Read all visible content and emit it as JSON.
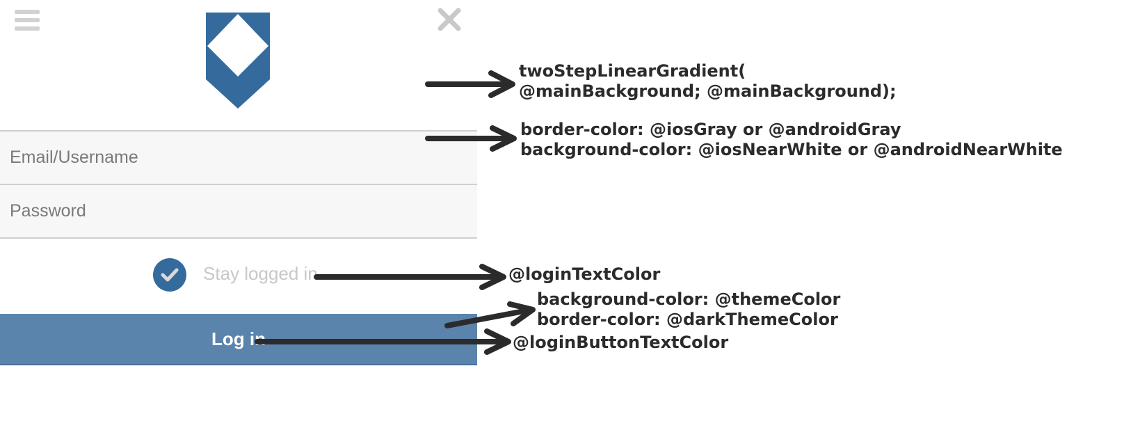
{
  "header": {
    "menu_icon": "hamburger-menu-icon",
    "close_icon": "close-icon",
    "logo_icon": "shield-logo-icon",
    "logo_color": "#356a9d"
  },
  "form": {
    "email_placeholder": "Email/Username",
    "password_placeholder": "Password",
    "stay_logged_in_label": "Stay logged in",
    "stay_logged_in_checked": true,
    "login_button_label": "Log in",
    "field_background": "#f7f7f7",
    "field_border": "#cfcfcf",
    "button_background": "#5b84ad",
    "checkbox_color": "#356a9d"
  },
  "annotations": {
    "background_line1": "twoStepLinearGradient(",
    "background_line2": "@mainBackground; @mainBackground);",
    "fields_line1": "border-color: @iosGray or @androidGray",
    "fields_line2": "background-color: @iosNearWhite or @androidNearWhite",
    "login_text": "@loginTextColor",
    "button_line1": "background-color: @themeColor",
    "button_line2": "border-color: @darkThemeColor",
    "button_text": "@loginButtonTextColor"
  }
}
